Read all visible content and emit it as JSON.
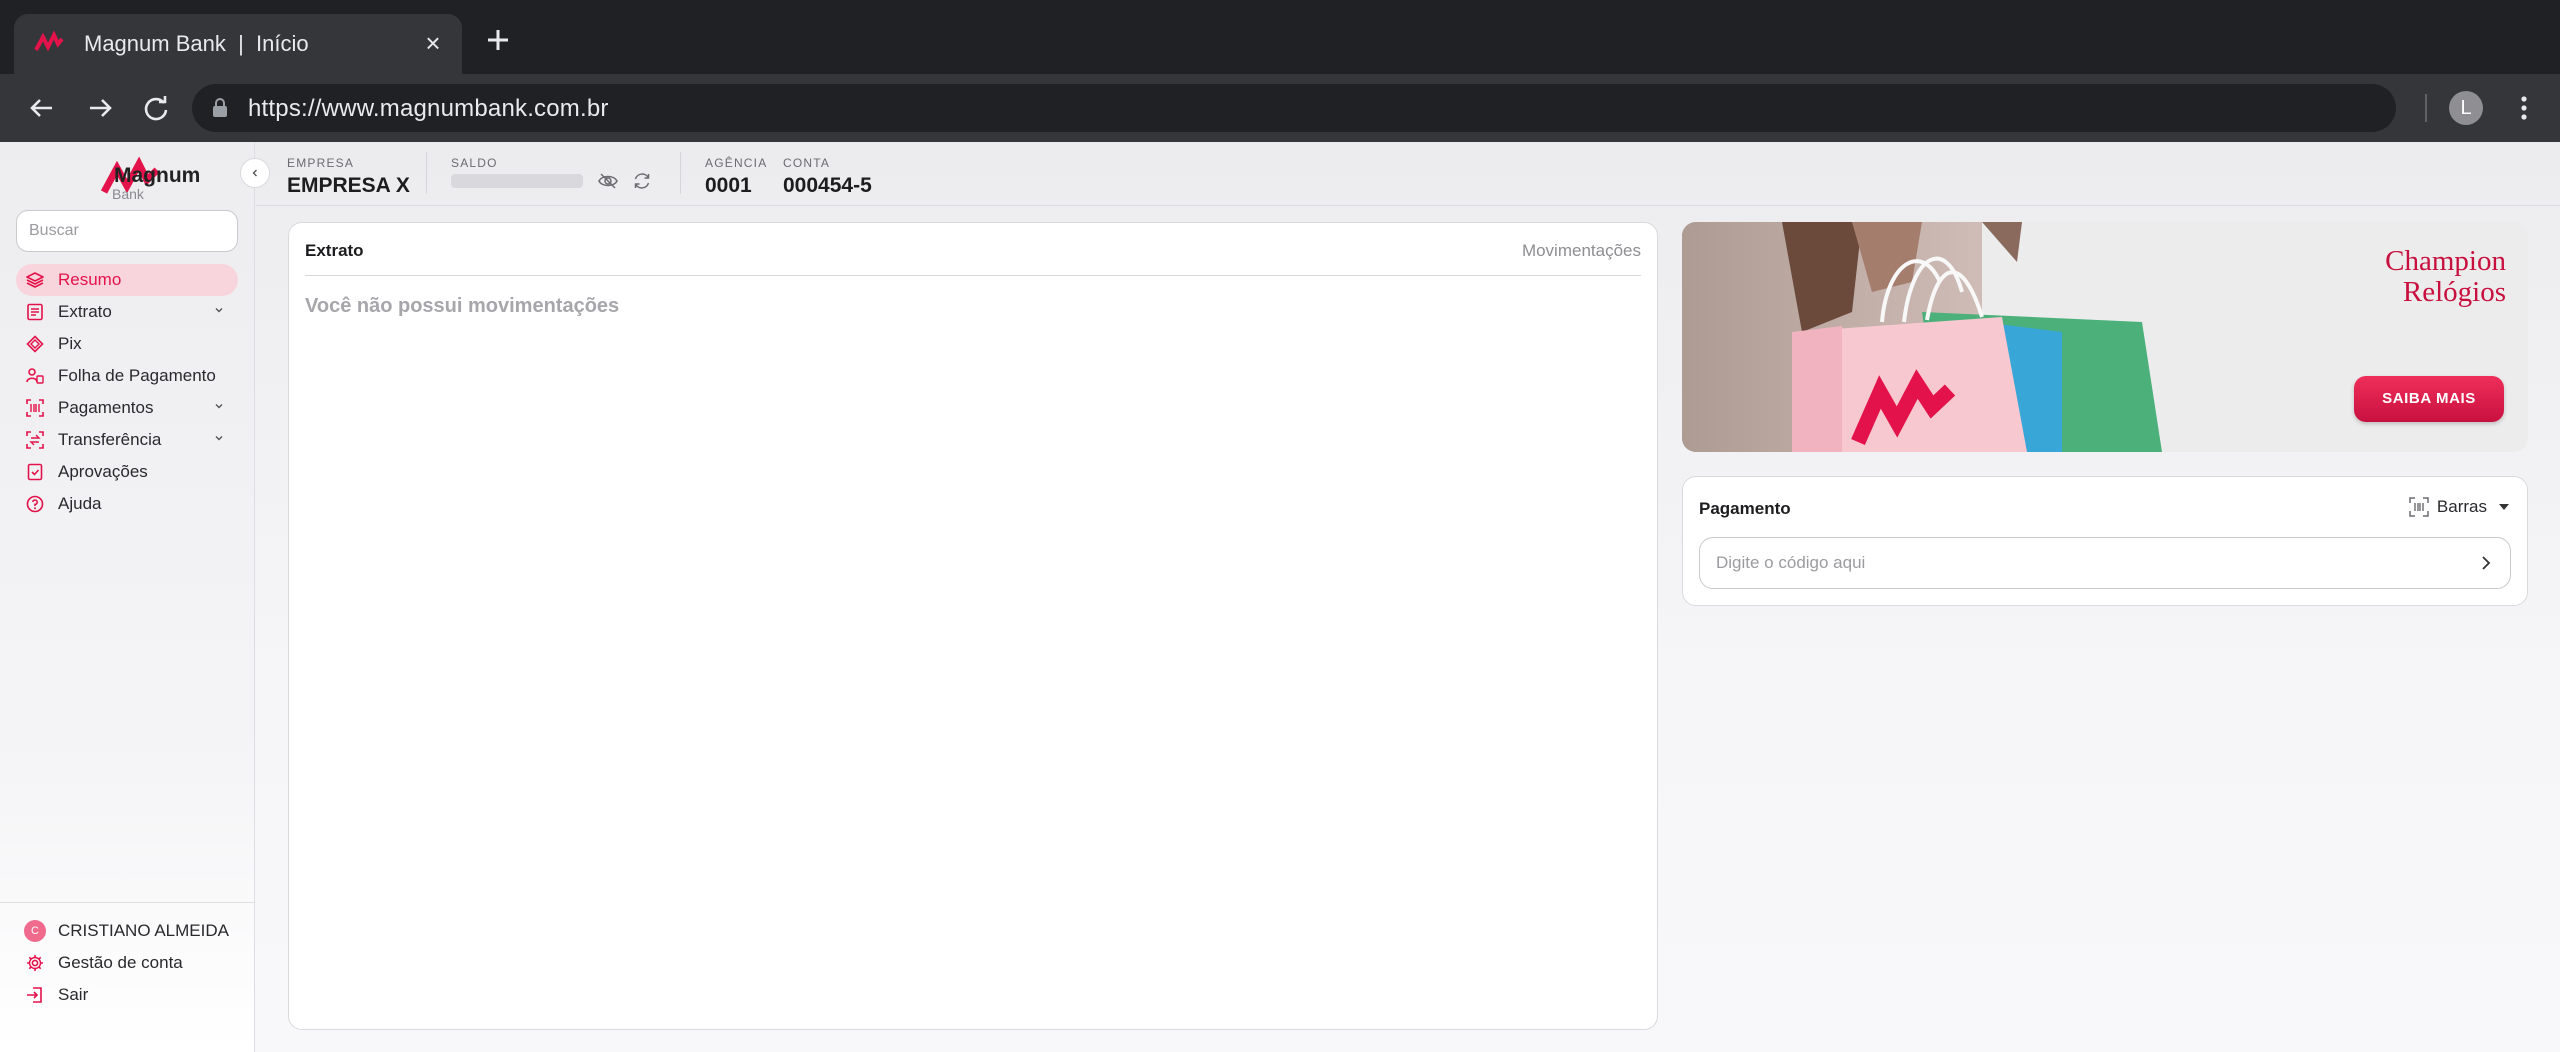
{
  "browser": {
    "tab_title": "Magnum Bank  |  Início",
    "url": "https://www.magnumbank.com.br",
    "profile_initial": "L",
    "icons": [
      "back-icon",
      "forward-icon",
      "reload-icon",
      "lock-icon",
      "close-icon",
      "plus-icon",
      "kebab-icon"
    ]
  },
  "brand": {
    "name": "Magnum",
    "sub": "Bank",
    "accent": "#e3124a"
  },
  "sidebar": {
    "search_placeholder": "Buscar",
    "items": [
      {
        "label": "Resumo",
        "icon": "layers-icon",
        "active": true
      },
      {
        "label": "Extrato",
        "icon": "document-icon",
        "expandable": true
      },
      {
        "label": "Pix",
        "icon": "pix-icon"
      },
      {
        "label": "Folha de Pagamento",
        "icon": "payroll-icon"
      },
      {
        "label": "Pagamentos",
        "icon": "barcode-icon",
        "expandable": true
      },
      {
        "label": "Transferência",
        "icon": "transfer-icon",
        "expandable": true
      },
      {
        "label": "Aprovações",
        "icon": "approval-icon"
      },
      {
        "label": "Ajuda",
        "icon": "help-icon"
      }
    ],
    "user": {
      "initial": "C",
      "name": "CRISTIANO ALMEIDA"
    },
    "account_label": "Gestão de conta",
    "logout_label": "Sair"
  },
  "header": {
    "empresa_label": "EMPRESA",
    "empresa_value": "EMPRESA X",
    "saldo_label": "SALDO",
    "agencia_label": "AGÊNCIA",
    "agencia_value": "0001",
    "conta_label": "CONTA",
    "conta_value": "000454-5"
  },
  "extrato": {
    "title": "Extrato",
    "link": "Movimentações",
    "empty_message": "Você não possui movimentações"
  },
  "banner": {
    "title_line1": "Champion",
    "title_line2": "Relógios",
    "button": "SAIBA MAIS"
  },
  "pagamento": {
    "title": "Pagamento",
    "type": "Barras",
    "placeholder": "Digite o código aqui"
  }
}
